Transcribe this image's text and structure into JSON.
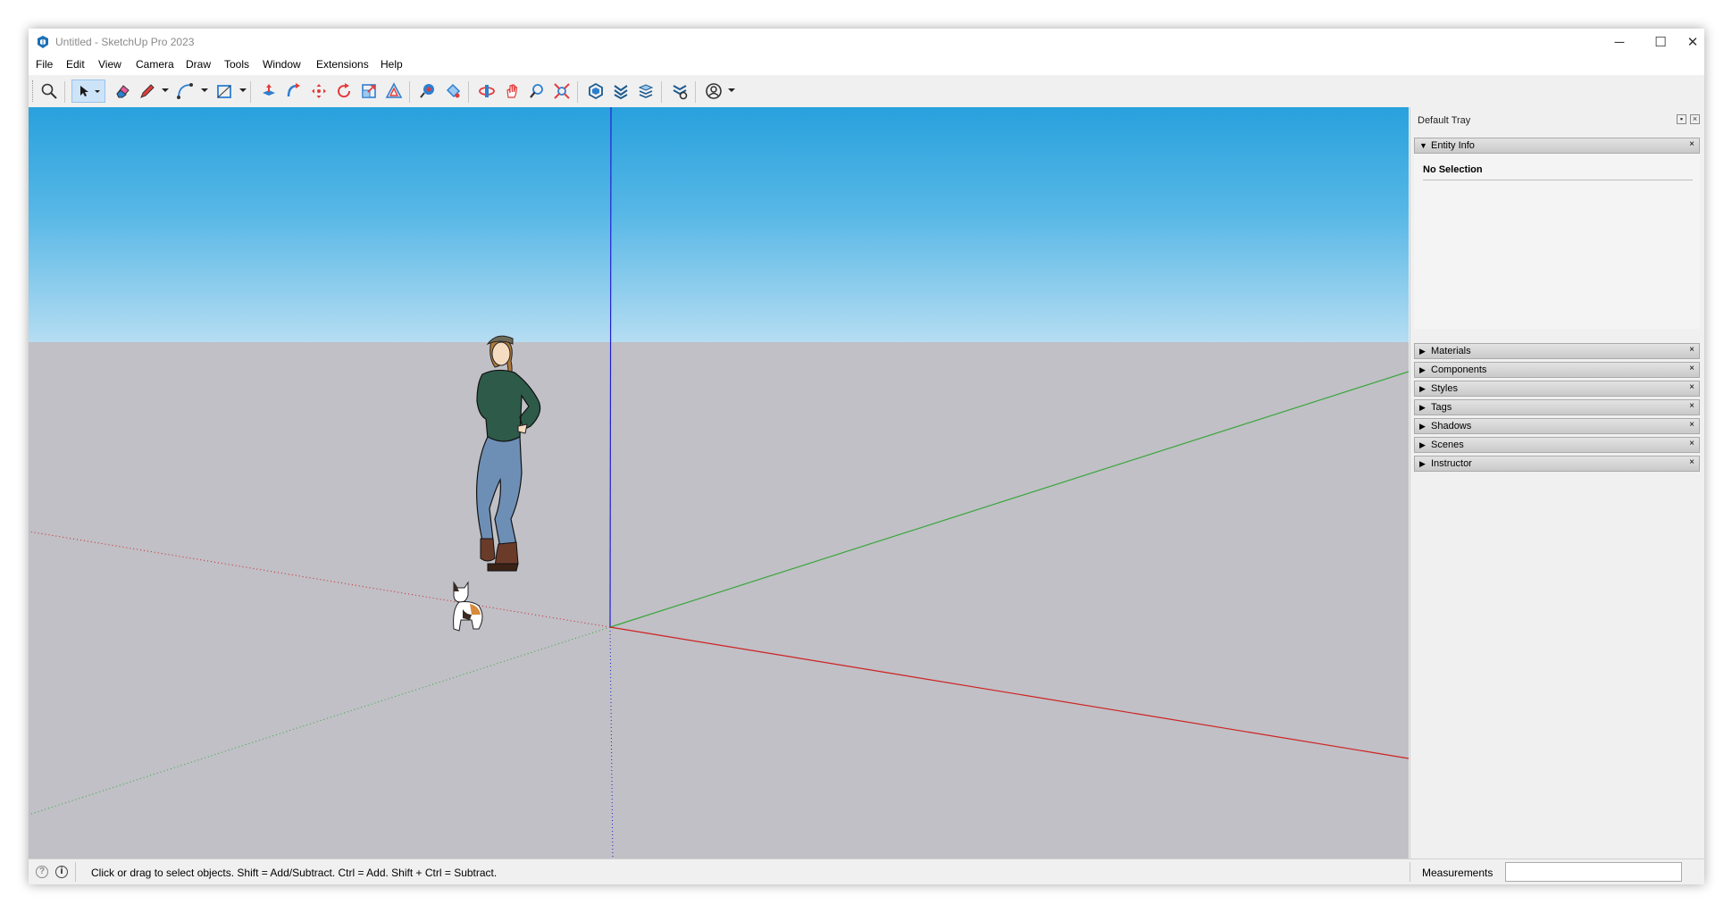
{
  "window": {
    "title": "Untitled - SketchUp Pro 2023",
    "controls": {
      "minimize": "─",
      "maximize": "☐",
      "close": "✕"
    }
  },
  "menubar": {
    "items": [
      "File",
      "Edit",
      "View",
      "Camera",
      "Draw",
      "Tools",
      "Window",
      "Extensions",
      "Help"
    ]
  },
  "toolbar": {
    "buttons": [
      "search-icon",
      "select-arrow-icon",
      "eraser-icon",
      "pencil-line-icon",
      "arc-icon",
      "rectangle-icon",
      "push-pull-icon",
      "follow-me-icon",
      "move-icon",
      "rotate-icon",
      "scale-icon",
      "offset-icon",
      "tape-measure-icon",
      "paint-bucket-icon",
      "orbit-icon",
      "pan-icon",
      "zoom-icon",
      "zoom-extents-icon",
      "warehouse-icon",
      "extension-warehouse-icon",
      "layout-icon",
      "extension-manager-icon",
      "account-icon"
    ]
  },
  "viewport": {
    "sky_colors": [
      "#28a1dd",
      "#b5ddf2"
    ],
    "ground_color": "#c0c0c6",
    "axis_colors": {
      "red": "#d02020",
      "green": "#3aa53a",
      "blue": "#2020d0"
    }
  },
  "tray": {
    "title": "Default Tray",
    "entity_info": {
      "label": "Entity Info",
      "selection": "No Selection",
      "close": "×"
    },
    "panels": [
      {
        "label": "Materials",
        "close": "×"
      },
      {
        "label": "Components",
        "close": "×"
      },
      {
        "label": "Styles",
        "close": "×"
      },
      {
        "label": "Tags",
        "close": "×"
      },
      {
        "label": "Shadows",
        "close": "×"
      },
      {
        "label": "Scenes",
        "close": "×"
      },
      {
        "label": "Instructor",
        "close": "×"
      }
    ]
  },
  "statusbar": {
    "geo_icon": "?",
    "info_icon": "i",
    "hint": "Click or drag to select objects. Shift = Add/Subtract. Ctrl = Add. Shift + Ctrl = Subtract.",
    "measurements_label": "Measurements",
    "measurements_value": ""
  }
}
